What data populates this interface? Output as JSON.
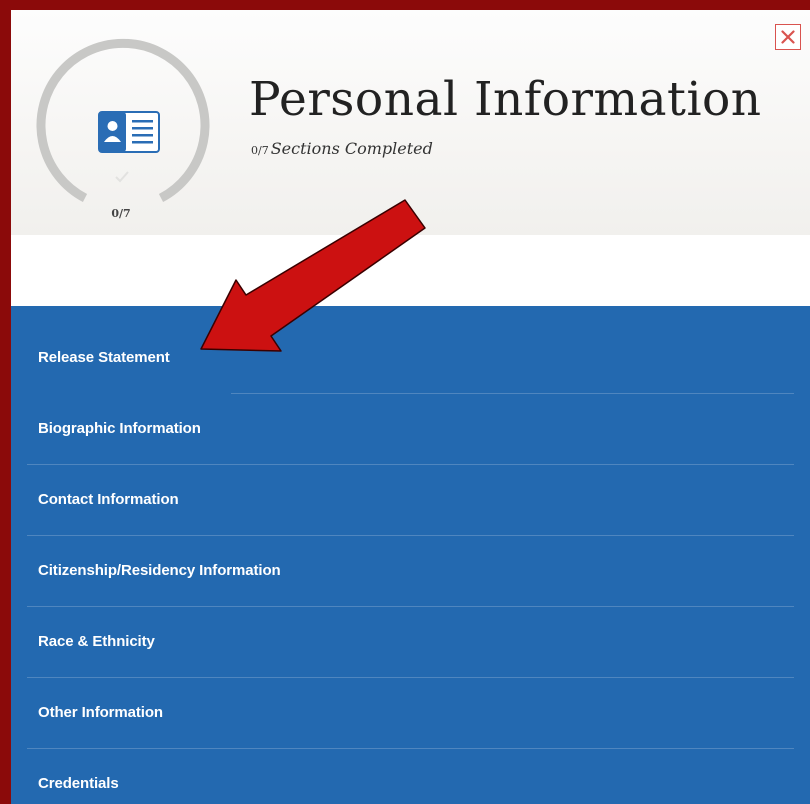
{
  "header": {
    "title": "Personal Information",
    "subtitle_fraction": "0/7",
    "subtitle_text": "Sections Completed",
    "progress": {
      "completed": 0,
      "total": 7,
      "label": "0/7"
    },
    "section_icon": "id-card-icon",
    "close_icon": "close-icon"
  },
  "menu": {
    "items": [
      {
        "label": "Release Statement"
      },
      {
        "label": "Biographic Information"
      },
      {
        "label": "Contact Information"
      },
      {
        "label": "Citizenship/Residency Information"
      },
      {
        "label": "Race & Ethnicity"
      },
      {
        "label": "Other Information"
      },
      {
        "label": "Credentials"
      }
    ]
  },
  "annotation": {
    "icon": "red-arrow-icon",
    "color": "#cc1111"
  },
  "colors": {
    "frame": "#8b0a0a",
    "menu_background": "#2369b0",
    "accent_blue": "#2a6db5",
    "close_red": "#d9534f"
  }
}
